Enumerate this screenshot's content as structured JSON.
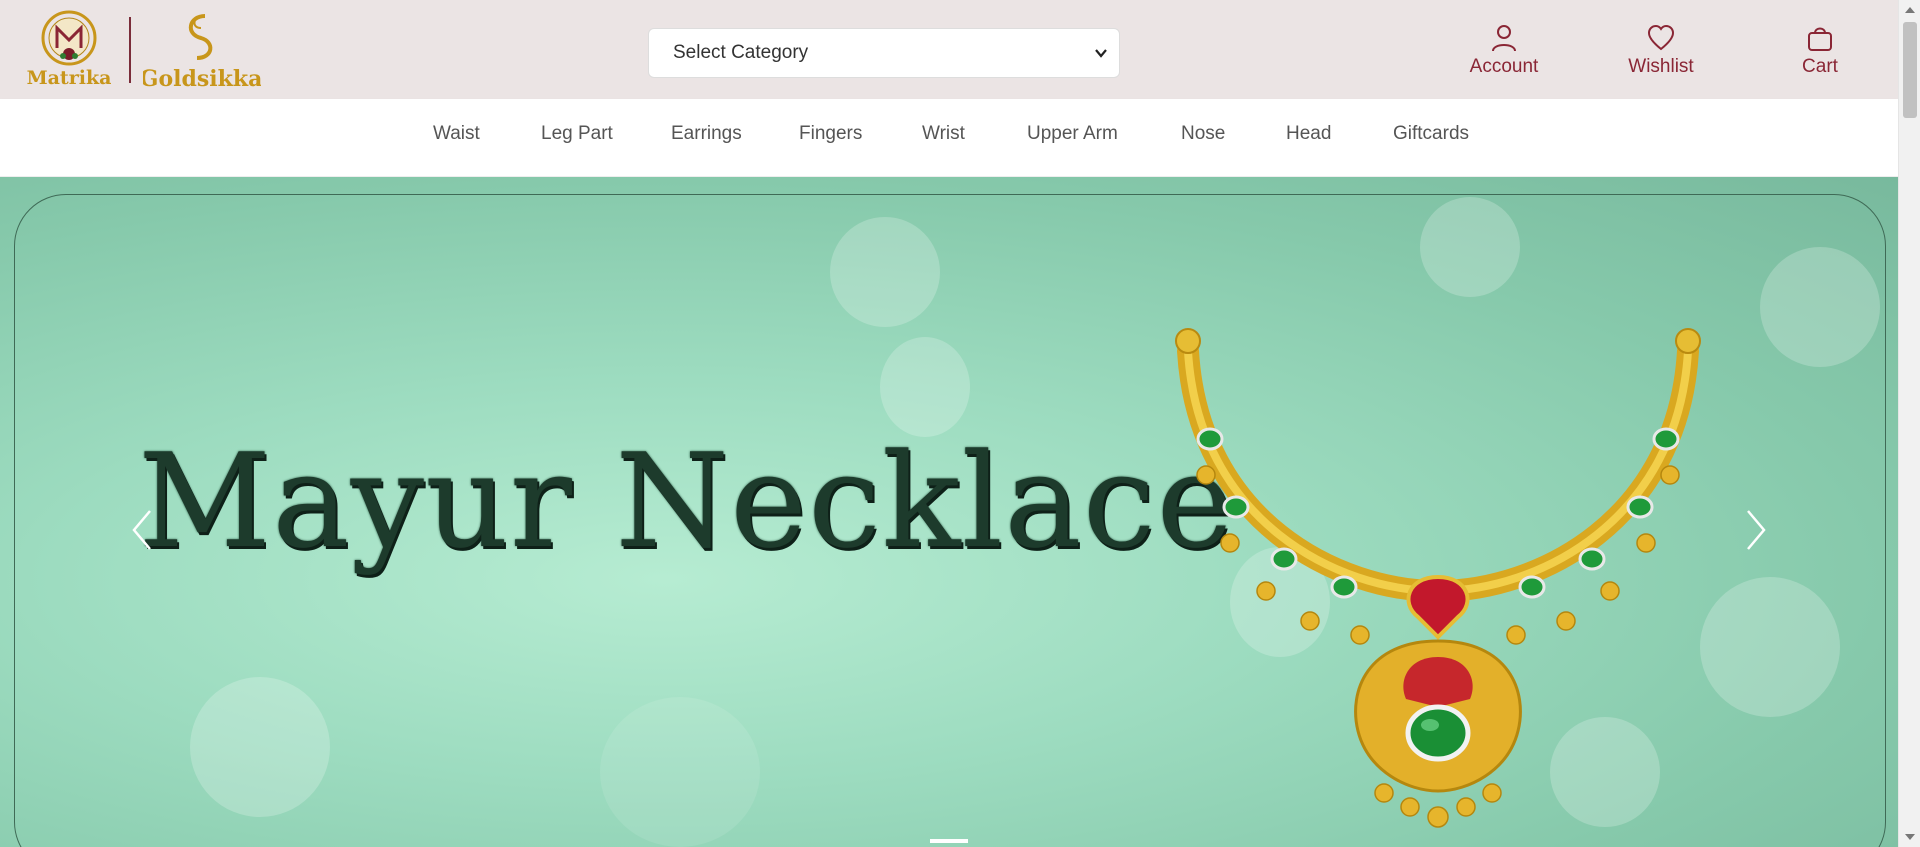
{
  "brand": {
    "logo_primary": "Matrika",
    "logo_secondary": "Goldsikka",
    "accent_color": "#8a2635",
    "gold_color": "#c8961b"
  },
  "header": {
    "category_select": {
      "selected": "Select Category"
    },
    "actions": {
      "account": {
        "label": "Account",
        "icon": "user-icon"
      },
      "wishlist": {
        "label": "Wishlist",
        "icon": "heart-icon"
      },
      "cart": {
        "label": "Cart",
        "icon": "shopping-bag-icon"
      }
    }
  },
  "nav": {
    "items": [
      {
        "label": "Waist"
      },
      {
        "label": "Leg Part"
      },
      {
        "label": "Earrings"
      },
      {
        "label": "Fingers"
      },
      {
        "label": "Wrist"
      },
      {
        "label": "Upper Arm"
      },
      {
        "label": "Nose"
      },
      {
        "label": "Head"
      },
      {
        "label": "Giftcards"
      }
    ]
  },
  "banner": {
    "headline": "Mayur Necklace",
    "background_color": "#9ddcc0",
    "prev_icon": "chevron-left-icon",
    "next_icon": "chevron-right-icon",
    "active_slide": 1
  }
}
